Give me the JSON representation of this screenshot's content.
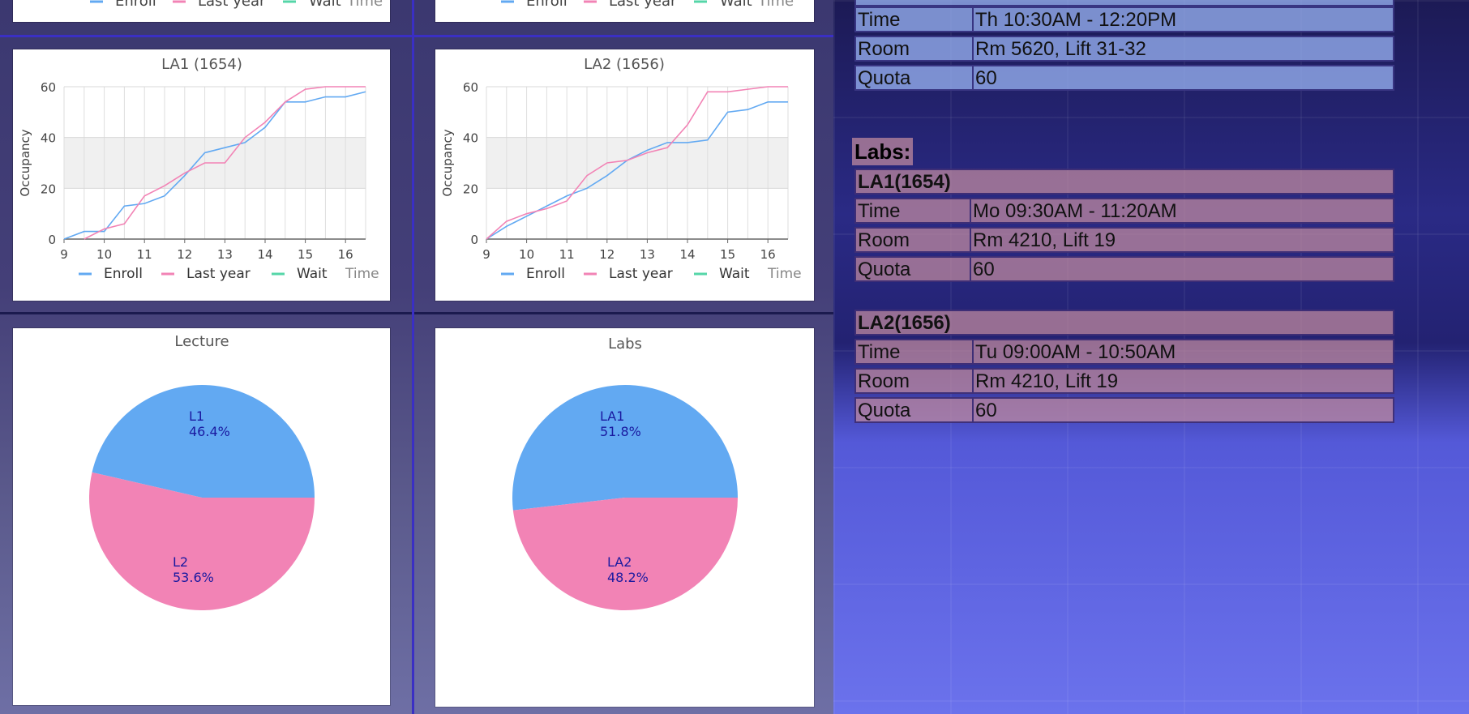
{
  "legend": {
    "enroll": "Enroll",
    "last_year": "Last year",
    "wait": "Wait",
    "time": "Time",
    "colors": {
      "enroll": "#62a9f2",
      "last_year": "#f283b5",
      "wait": "#55d6a8"
    }
  },
  "charts": {
    "la1": {
      "title": "LA1 (1654)",
      "ylabel": "Occupancy"
    },
    "la2": {
      "title": "LA2 (1656)",
      "ylabel": "Occupancy"
    },
    "lecture": {
      "title": "Lecture"
    },
    "labs": {
      "title": "Labs"
    }
  },
  "chart_data": [
    {
      "type": "line",
      "title": "LA1 (1654)",
      "ylabel": "Occupancy",
      "xlim": [
        9,
        16.5
      ],
      "ylim": [
        0,
        60
      ],
      "xticks": [
        9,
        10,
        11,
        12,
        13,
        14,
        15,
        16
      ],
      "yticks": [
        0,
        20,
        40,
        60
      ],
      "grid": true,
      "legend_position": "bottom",
      "x": [
        9,
        9.5,
        10,
        10.5,
        11,
        11.5,
        12,
        12.5,
        13,
        13.5,
        14,
        14.5,
        15,
        15.5,
        16,
        16.5
      ],
      "series": [
        {
          "name": "Enroll",
          "values": [
            0,
            3,
            3,
            13,
            14,
            17,
            25,
            34,
            36,
            38,
            44,
            54,
            54,
            56,
            56,
            58
          ]
        },
        {
          "name": "Last year",
          "values": [
            null,
            0,
            4,
            6,
            17,
            21,
            26,
            30,
            30,
            40,
            46,
            54,
            59,
            60,
            60,
            60
          ]
        }
      ]
    },
    {
      "type": "line",
      "title": "LA2 (1656)",
      "ylabel": "Occupancy",
      "xlim": [
        9,
        16.5
      ],
      "ylim": [
        0,
        60
      ],
      "xticks": [
        9,
        10,
        11,
        12,
        13,
        14,
        15,
        16
      ],
      "yticks": [
        0,
        20,
        40,
        60
      ],
      "grid": true,
      "legend_position": "bottom",
      "x": [
        9,
        9.5,
        10,
        10.5,
        11,
        11.5,
        12,
        12.5,
        13,
        13.5,
        14,
        14.5,
        15,
        15.5,
        16,
        16.5
      ],
      "series": [
        {
          "name": "Enroll",
          "values": [
            0,
            5,
            9,
            13,
            17,
            20,
            25,
            31,
            35,
            38,
            38,
            39,
            50,
            51,
            54,
            54
          ]
        },
        {
          "name": "Last year",
          "values": [
            0,
            7,
            10,
            12,
            15,
            25,
            30,
            31,
            34,
            36,
            45,
            58,
            58,
            59,
            60,
            60
          ]
        }
      ]
    },
    {
      "type": "pie",
      "title": "Lecture",
      "labels": [
        "L1",
        "L2"
      ],
      "values": [
        46.4,
        53.6
      ]
    },
    {
      "type": "pie",
      "title": "Labs",
      "labels": [
        "LA1",
        "LA2"
      ],
      "values": [
        51.8,
        48.2
      ]
    }
  ],
  "lecture_info": {
    "time_label": "Time",
    "time_value": "Th 10:30AM - 12:20PM",
    "room_label": "Room",
    "room_value": "Rm 5620, Lift 31-32",
    "quota_label": "Quota",
    "quota_value": "60"
  },
  "labs": {
    "heading": "Labs:",
    "items": [
      {
        "name": "LA1(1654)",
        "time_label": "Time",
        "time_value": "Mo 09:30AM - 11:20AM",
        "room_label": "Room",
        "room_value": "Rm 4210, Lift 19",
        "quota_label": "Quota",
        "quota_value": "60"
      },
      {
        "name": "LA2(1656)",
        "time_label": "Time",
        "time_value": "Tu 09:00AM - 10:50AM",
        "room_label": "Room",
        "room_value": "Rm 4210, Lift 19",
        "quota_label": "Quota",
        "quota_value": "60"
      }
    ]
  }
}
